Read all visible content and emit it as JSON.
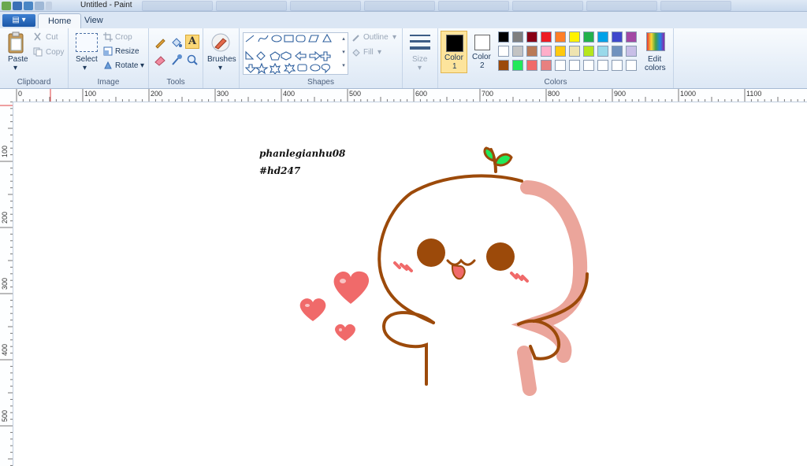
{
  "window": {
    "title": "Untitled - Paint"
  },
  "tabs": [
    {
      "label": "Home"
    },
    {
      "label": "View"
    }
  ],
  "clipboard": {
    "paste": "Paste",
    "cut": "Cut",
    "copy": "Copy",
    "group": "Clipboard"
  },
  "image": {
    "select": "Select",
    "crop": "Crop",
    "resize": "Resize",
    "rotate": "Rotate",
    "group": "Image"
  },
  "tools": {
    "group": "Tools"
  },
  "brushes": {
    "label": "Brushes"
  },
  "shapes": {
    "outline": "Outline",
    "fill": "Fill",
    "group": "Shapes"
  },
  "size": {
    "label": "Size"
  },
  "colors": {
    "color1_label": "Color",
    "color1_num": "1",
    "color2_label": "Color",
    "color2_num": "2",
    "edit1": "Edit",
    "edit2": "colors",
    "group": "Colors",
    "color1": "#000000",
    "color2": "#ffffff",
    "palette_row1": [
      "#000000",
      "#7f7f7f",
      "#880015",
      "#ed1c24",
      "#ff7f27",
      "#fff200",
      "#22b14c",
      "#00a2e8",
      "#3f48cc",
      "#a349a4"
    ],
    "palette_row2": [
      "#ffffff",
      "#c3c3c3",
      "#b97a57",
      "#ffaec9",
      "#ffc90e",
      "#efe4b0",
      "#b5e61d",
      "#99d9ea",
      "#7092be",
      "#c8bfe7"
    ],
    "palette_row3": [
      "#9c4a0a",
      "#22e85a",
      "#f06a6a",
      "#e88080",
      "#ffffff",
      "#ffffff",
      "#ffffff",
      "#ffffff",
      "#ffffff",
      "#ffffff"
    ]
  },
  "ruler": {
    "h_ticks": [
      "0",
      "100",
      "200",
      "300",
      "400",
      "500",
      "600",
      "700",
      "800",
      "900",
      "1000",
      "1100"
    ],
    "v_ticks": [
      "100",
      "200",
      "300",
      "400",
      "500"
    ]
  },
  "canvas": {
    "signature_line1": "phanlegianhu08",
    "signature_line2": "#hd247"
  }
}
